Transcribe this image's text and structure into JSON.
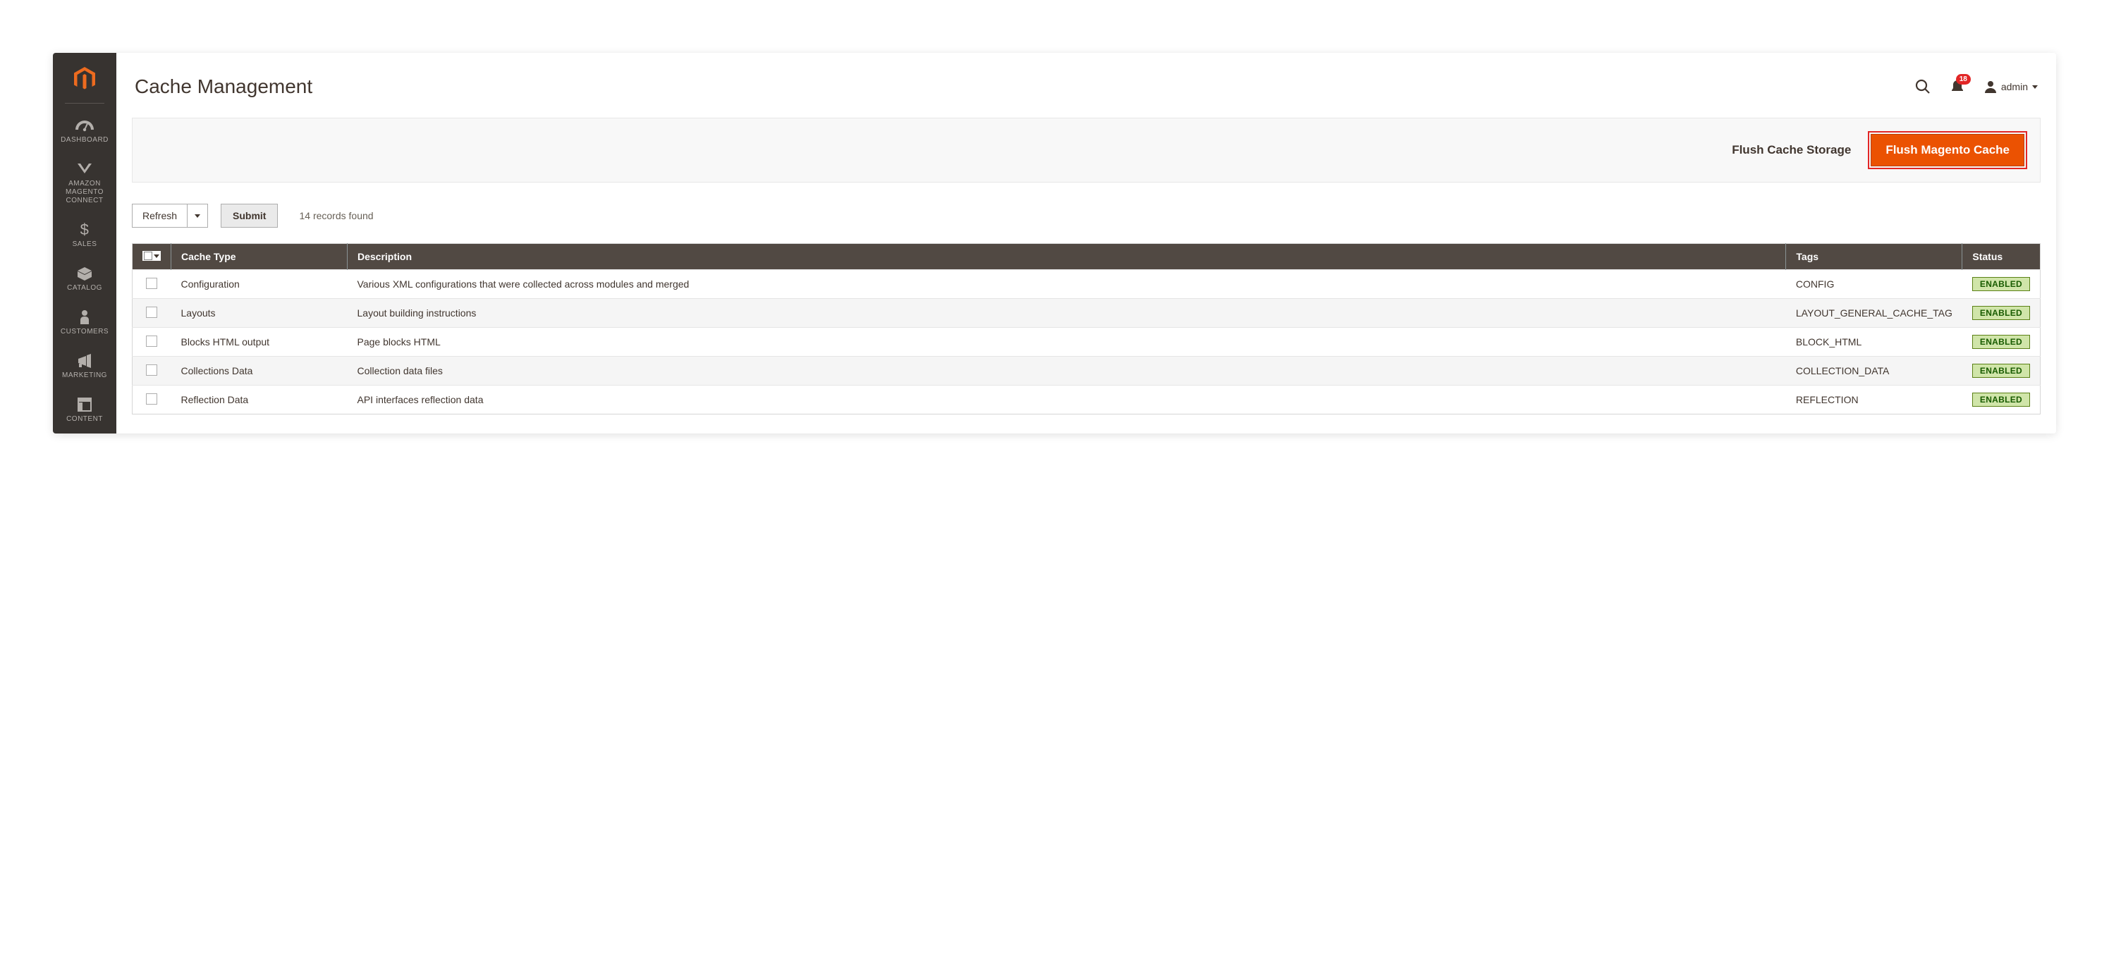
{
  "sidebar": {
    "items": [
      {
        "label": "DASHBOARD"
      },
      {
        "label": "AMAZON\nMAGENTO\nCONNECT"
      },
      {
        "label": "SALES"
      },
      {
        "label": "CATALOG"
      },
      {
        "label": "CUSTOMERS"
      },
      {
        "label": "MARKETING"
      },
      {
        "label": "CONTENT"
      }
    ]
  },
  "header": {
    "title": "Cache Management",
    "notification_count": "18",
    "user_name": "admin"
  },
  "action_bar": {
    "flush_storage_label": "Flush Cache Storage",
    "flush_magento_label": "Flush Magento Cache"
  },
  "toolbar": {
    "mass_action_selected": "Refresh",
    "submit_label": "Submit",
    "records_found": "14 records found"
  },
  "table": {
    "columns": {
      "type": "Cache Type",
      "description": "Description",
      "tags": "Tags",
      "status": "Status"
    },
    "status_enabled_label": "ENABLED",
    "rows": [
      {
        "type": "Configuration",
        "description": "Various XML configurations that were collected across modules and merged",
        "tags": "CONFIG",
        "status": "ENABLED"
      },
      {
        "type": "Layouts",
        "description": "Layout building instructions",
        "tags": "LAYOUT_GENERAL_CACHE_TAG",
        "status": "ENABLED"
      },
      {
        "type": "Blocks HTML output",
        "description": "Page blocks HTML",
        "tags": "BLOCK_HTML",
        "status": "ENABLED"
      },
      {
        "type": "Collections Data",
        "description": "Collection data files",
        "tags": "COLLECTION_DATA",
        "status": "ENABLED"
      },
      {
        "type": "Reflection Data",
        "description": "API interfaces reflection data",
        "tags": "REFLECTION",
        "status": "ENABLED"
      }
    ]
  }
}
